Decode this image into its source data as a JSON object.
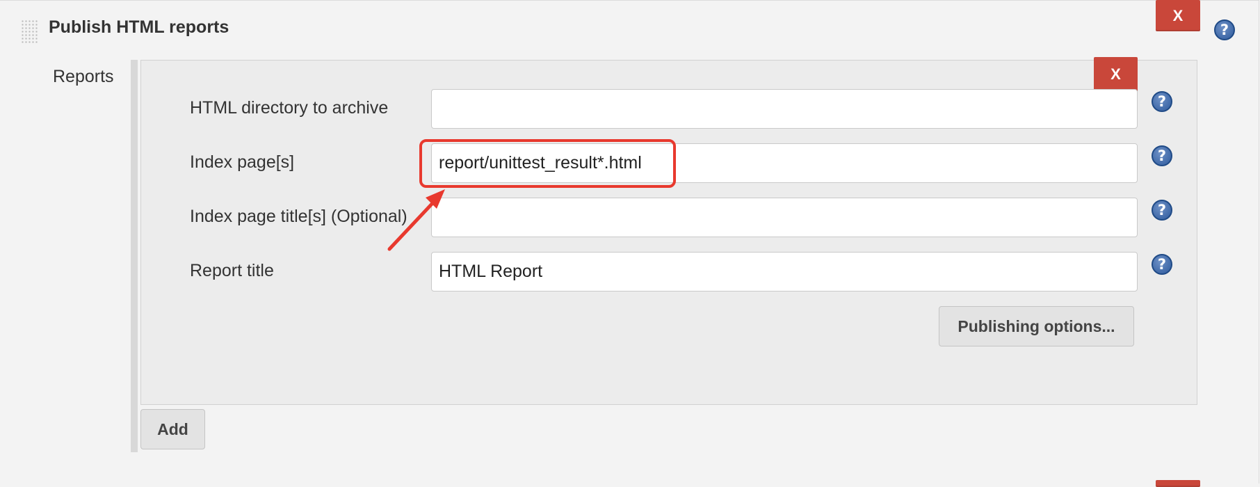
{
  "section": {
    "title": "Publish HTML reports",
    "delete_label": "X"
  },
  "reports": {
    "label": "Reports",
    "delete_label": "X",
    "fields": [
      {
        "label": "HTML directory to archive",
        "value": "",
        "help": "?"
      },
      {
        "label": "Index page[s]",
        "value": "report/unittest_result*.html",
        "help": "?"
      },
      {
        "label": "Index page title[s] (Optional)",
        "value": "",
        "help": "?"
      },
      {
        "label": "Report title",
        "value": "HTML Report",
        "help": "?"
      }
    ],
    "publishing_options_label": "Publishing options...",
    "add_label": "Add"
  },
  "help_glyph": "?",
  "annotation": {
    "color": "#e8392e"
  },
  "colors": {
    "delete": "#c9473a",
    "help": "#2e5a9c",
    "background": "#f3f3f3"
  }
}
